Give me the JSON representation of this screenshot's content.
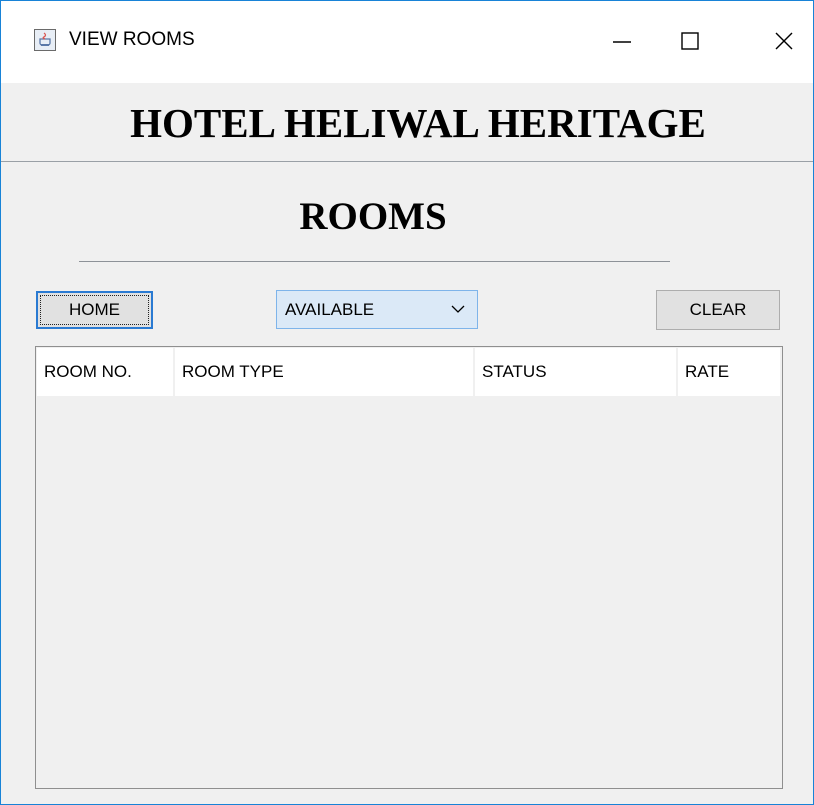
{
  "window": {
    "title": "VIEW ROOMS",
    "icon": "java-cup-icon",
    "controls": [
      "minimize-icon",
      "maximize-icon",
      "close-icon"
    ],
    "accent_color": "#1883d7"
  },
  "header": {
    "hotel_name": "HOTEL HELIWAL HERITAGE",
    "section_title": "ROOMS"
  },
  "toolbar": {
    "home_label": "HOME",
    "clear_label": "CLEAR",
    "status_filter": {
      "selected": "AVAILABLE",
      "icon": "chevron-down-icon"
    }
  },
  "table": {
    "columns": [
      "ROOM NO.",
      "ROOM TYPE",
      "STATUS",
      "RATE"
    ],
    "rows": []
  }
}
